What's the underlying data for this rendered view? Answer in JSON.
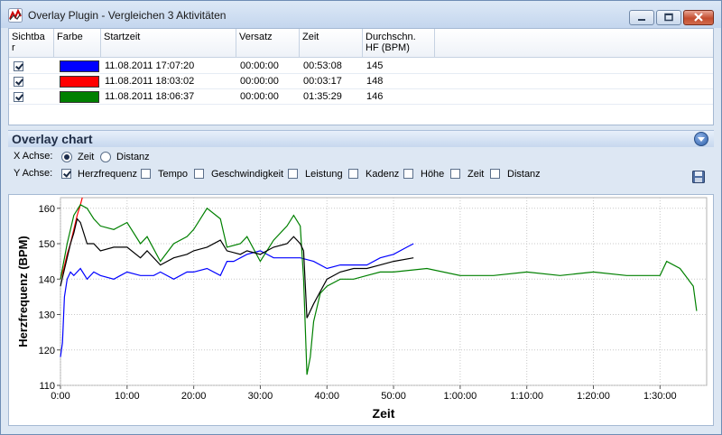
{
  "window": {
    "title": "Overlay Plugin - Vergleichen 3 Aktivitäten"
  },
  "grid": {
    "headers": {
      "visible": "Sichtba",
      "visible2": "r",
      "color": "Farbe",
      "start": "Startzeit",
      "offset": "Versatz",
      "time": "Zeit",
      "avg_hr": "Durchschn.",
      "avg_hr2": "HF (BPM)"
    },
    "rows": [
      {
        "visible": true,
        "color": "#0000ff",
        "start": "11.08.2011 17:07:20",
        "offset": "00:00:00",
        "time": "00:53:08",
        "avg_hr": "145"
      },
      {
        "visible": true,
        "color": "#ff0000",
        "start": "11.08.2011 18:03:02",
        "offset": "00:00:00",
        "time": "00:03:17",
        "avg_hr": "148"
      },
      {
        "visible": true,
        "color": "#008000",
        "start": "11.08.2011 18:06:37",
        "offset": "00:00:00",
        "time": "01:35:29",
        "avg_hr": "146"
      }
    ]
  },
  "panel": {
    "title": "Overlay chart",
    "x_axis_label": "X Achse:",
    "x_options": [
      {
        "label": "Zeit",
        "selected": true
      },
      {
        "label": "Distanz",
        "selected": false
      }
    ],
    "y_axis_label": "Y Achse:",
    "y_options": [
      {
        "label": "Herzfrequenz",
        "checked": true
      },
      {
        "label": "Tempo",
        "checked": false
      },
      {
        "label": "Geschwindigkeit",
        "checked": false
      },
      {
        "label": "Leistung",
        "checked": false
      },
      {
        "label": "Kadenz",
        "checked": false
      },
      {
        "label": "Höhe",
        "checked": false
      },
      {
        "label": "Zeit",
        "checked": false
      },
      {
        "label": "Distanz",
        "checked": false
      }
    ]
  },
  "chart_data": {
    "type": "line",
    "xlabel": "Zeit",
    "ylabel": "Herzfrequenz (BPM)",
    "xlim": [
      0,
      97
    ],
    "ylim": [
      110,
      163
    ],
    "grid": true,
    "x_ticks": [
      0,
      10,
      20,
      30,
      40,
      50,
      60,
      70,
      80,
      90
    ],
    "x_tick_labels": [
      "0:00",
      "10:00",
      "20:00",
      "30:00",
      "40:00",
      "50:00",
      "1:00:00",
      "1:10:00",
      "1:20:00",
      "1:30:00"
    ],
    "y_ticks": [
      110,
      120,
      130,
      140,
      150,
      160
    ],
    "series": [
      {
        "color": "#0000ff",
        "x": [
          0,
          0.3,
          0.6,
          1,
          1.5,
          2,
          3,
          4,
          5,
          6,
          8,
          9,
          10,
          12,
          14,
          15,
          17,
          19,
          20,
          22,
          24,
          25,
          26,
          28,
          30,
          32,
          34,
          36,
          38,
          40,
          42,
          44,
          46,
          48,
          50,
          52,
          53
        ],
        "y": [
          118,
          122,
          135,
          140,
          142,
          141,
          143,
          140,
          142,
          141,
          140,
          141,
          142,
          141,
          141,
          142,
          140,
          142,
          142,
          143,
          141,
          145,
          145,
          147,
          148,
          146,
          146,
          146,
          145,
          143,
          144,
          144,
          144,
          146,
          147,
          149,
          150
        ]
      },
      {
        "color": "#ff0000",
        "x": [
          0,
          0.5,
          1,
          1.5,
          2,
          2.5,
          3,
          3.28
        ],
        "y": [
          140,
          143,
          147,
          150,
          154,
          158,
          161,
          163
        ]
      },
      {
        "color": "#008000",
        "x": [
          0,
          1,
          2,
          3,
          4,
          5,
          6,
          8,
          10,
          12,
          13,
          15,
          17,
          19,
          20,
          22,
          24,
          25,
          27,
          28,
          30,
          32,
          34,
          35,
          36,
          36.5,
          37,
          37.5,
          38,
          39,
          40,
          42,
          44,
          46,
          48,
          50,
          55,
          60,
          65,
          70,
          75,
          80,
          85,
          90,
          91,
          93,
          95,
          95.5
        ],
        "y": [
          140,
          150,
          158,
          161,
          160,
          157,
          155,
          154,
          156,
          150,
          152,
          145,
          150,
          152,
          154,
          160,
          157,
          149,
          150,
          152,
          145,
          151,
          155,
          158,
          155,
          140,
          113,
          118,
          128,
          136,
          138,
          140,
          140,
          141,
          142,
          142,
          143,
          141,
          141,
          142,
          141,
          142,
          141,
          141,
          145,
          143,
          138,
          131
        ]
      },
      {
        "color": "#000000",
        "x": [
          0,
          0.5,
          1,
          1.5,
          2,
          2.5,
          3,
          4,
          5,
          6,
          8,
          10,
          12,
          13,
          15,
          17,
          19,
          20,
          22,
          24,
          25,
          27,
          28,
          30,
          32,
          34,
          35,
          36,
          36.5,
          37,
          38,
          40,
          42,
          44,
          46,
          48,
          50,
          53
        ],
        "y": [
          138,
          142,
          146,
          150,
          153,
          157,
          156,
          150,
          150,
          148,
          149,
          149,
          146,
          148,
          144,
          146,
          147,
          148,
          149,
          151,
          148,
          147,
          148,
          147,
          149,
          150,
          152,
          150,
          148,
          129,
          133,
          140,
          142,
          143,
          143,
          144,
          145,
          146
        ]
      }
    ]
  }
}
